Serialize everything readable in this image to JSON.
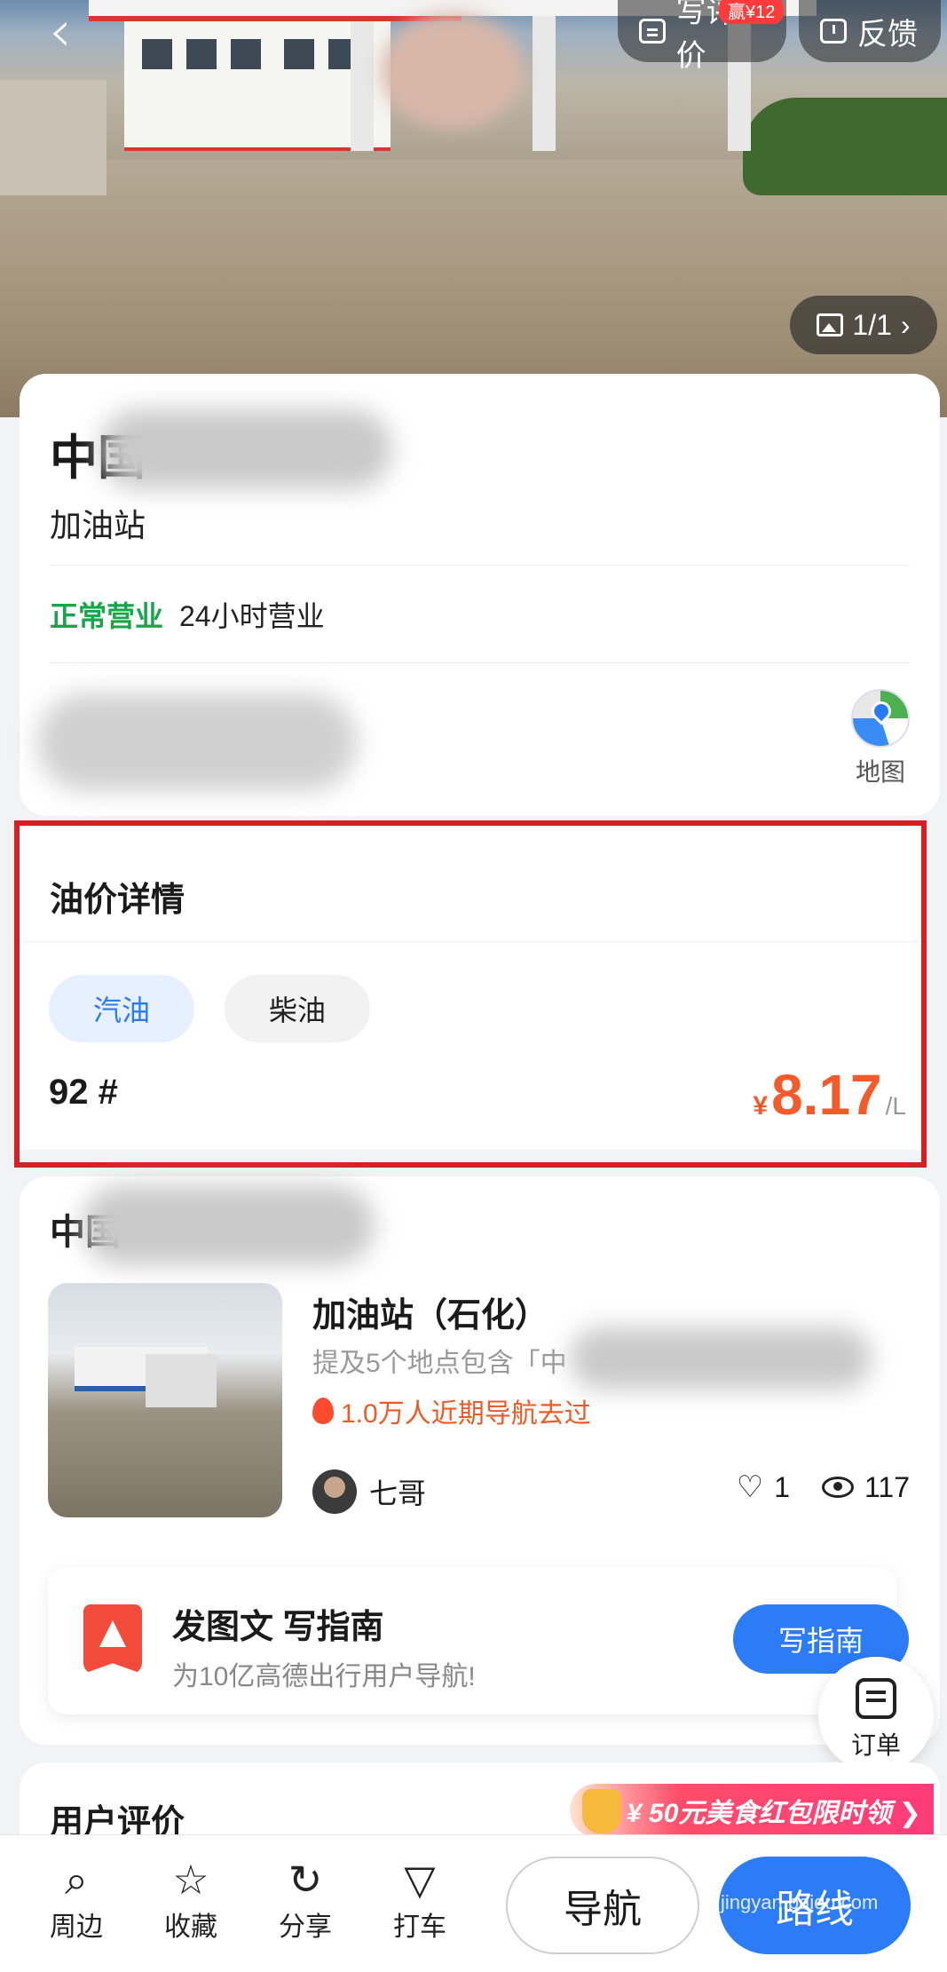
{
  "header": {
    "back_icon": "chevron-left-icon",
    "write_review": "写评价",
    "earn_badge": "赢¥12",
    "feedback": "反馈",
    "photo_counter": "1/1"
  },
  "poi": {
    "title_prefix": "中国",
    "category": "加油站",
    "status": "正常营业",
    "hours": "24小时营业",
    "map_label": "地图"
  },
  "oil": {
    "title": "油价详情",
    "tabs": [
      {
        "label": "汽油",
        "active": true
      },
      {
        "label": "柴油",
        "active": false
      }
    ],
    "grade": "92 #",
    "currency": "¥",
    "price": "8.17",
    "unit": "/L",
    "price_color": "#f55b2a"
  },
  "guide": {
    "title_prefix": "中国",
    "name": "加油站（石化）",
    "mention": "提及5个地点包含「中",
    "heat": "1.0万人近期导航去过",
    "author": "七哥",
    "likes": "1",
    "views": "117"
  },
  "promo": {
    "title": "发图文 写指南",
    "subtitle": "为10亿高德出行用户导航!",
    "button": "写指南"
  },
  "order_fab": {
    "label": "订单"
  },
  "reviews": {
    "title": "用户评价",
    "promo": "¥ 50元美食红包限时领 ❯"
  },
  "bottombar": {
    "items": [
      {
        "label": "周边",
        "icon": "search-icon"
      },
      {
        "label": "收藏",
        "icon": "star-icon"
      },
      {
        "label": "分享",
        "icon": "share-icon"
      },
      {
        "label": "打车",
        "icon": "taxi-icon"
      }
    ],
    "navigate": "导航",
    "route": "路线",
    "accent": "#2b7cf6"
  },
  "watermark": "jingyan.baidu.com"
}
